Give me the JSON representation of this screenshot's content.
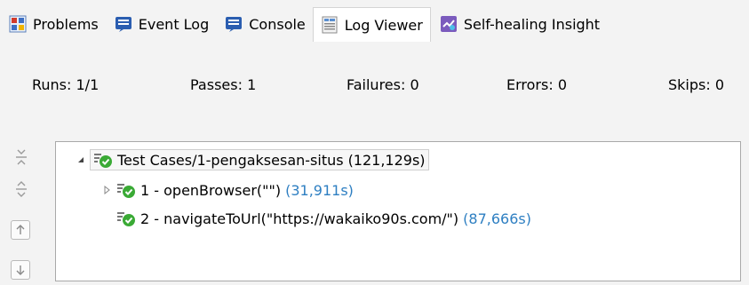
{
  "tabs": [
    {
      "label": "Problems",
      "icon": "problems-icon",
      "active": false
    },
    {
      "label": "Event Log",
      "icon": "event-log-icon",
      "active": false
    },
    {
      "label": "Console",
      "icon": "console-icon",
      "active": false
    },
    {
      "label": "Log Viewer",
      "icon": "log-viewer-icon",
      "active": true
    },
    {
      "label": "Self-healing Insight",
      "icon": "self-healing-icon",
      "active": false
    }
  ],
  "stats": {
    "runs": "Runs: 1/1",
    "passes": "Passes: 1",
    "failures": "Failures: 0",
    "errors": "Errors: 0",
    "skips": "Skips: 0"
  },
  "sidebar_tools": [
    {
      "name": "collapse-all-icon"
    },
    {
      "name": "expand-all-icon"
    },
    {
      "name": "previous-icon"
    },
    {
      "name": "next-icon"
    }
  ],
  "tree": {
    "root": {
      "label": "Test Cases/1-pengaksesan-situs",
      "duration": "(121,129s)",
      "status": "passed"
    },
    "children": [
      {
        "label": "1 - openBrowser(\"\")",
        "duration": "(31,911s)",
        "expandable": true
      },
      {
        "label": "2 - navigateToUrl(\"https://wakaiko90s.com/\")",
        "duration": "(87,666s)",
        "expandable": false
      }
    ]
  },
  "colors": {
    "pass_green": "#3aaa35",
    "duration_blue": "#2e7fc2",
    "border": "#a9a9a9"
  }
}
